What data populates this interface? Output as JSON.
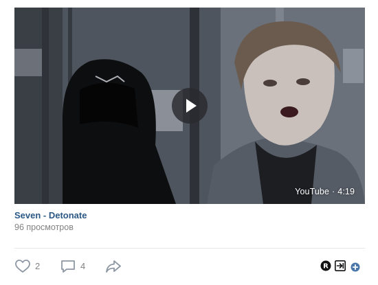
{
  "video": {
    "source": "YouTube",
    "separator": "·",
    "duration": "4:19",
    "title": "Seven - Detonate",
    "views": "96 просмотров"
  },
  "actions": {
    "likes": "2",
    "comments": "4"
  },
  "icons": {
    "play": "play-icon",
    "like": "heart-icon",
    "comment": "comment-icon",
    "share": "share-icon",
    "extension_r": "r-badge-icon",
    "extension_export": "export-icon",
    "add": "plus-icon"
  },
  "colors": {
    "link": "#2a5885",
    "muted": "#828282",
    "divider": "#e7e8ec",
    "add_blue": "#4a76a8"
  }
}
